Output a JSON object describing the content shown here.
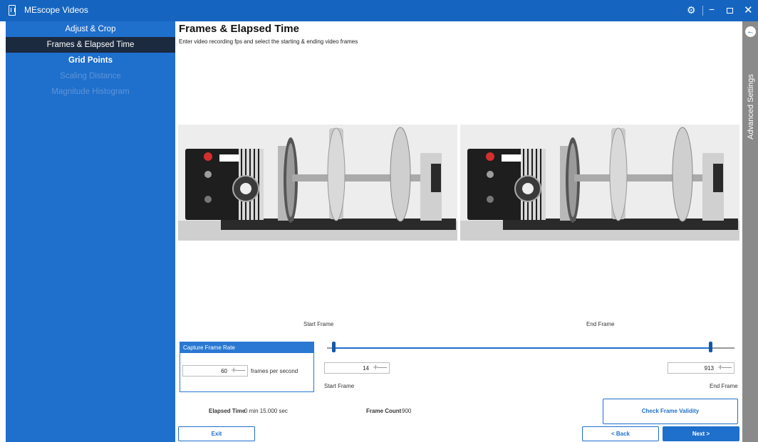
{
  "window": {
    "title": "MEscope Videos"
  },
  "titlebar": {
    "gear_icon": "gear-icon",
    "minimize_glyph": "−",
    "close_glyph": "✕"
  },
  "sidebar": {
    "items": [
      {
        "label": "Adjust & Crop",
        "state": "normal"
      },
      {
        "label": "Frames & Elapsed Time",
        "state": "active"
      },
      {
        "label": "Grid Points",
        "state": "bold"
      },
      {
        "label": "Scaling Distance",
        "state": "disabled"
      },
      {
        "label": "Magnitude Histogram",
        "state": "disabled"
      }
    ]
  },
  "main": {
    "title": "Frames & Elapsed Time",
    "subtitle": "Enter video recording fps and select the starting & ending video frames",
    "start_frame_caption": "Start Frame",
    "end_frame_caption": "End Frame"
  },
  "capture": {
    "header": "Capture Frame Rate",
    "fps_value": "60",
    "units": "frames per second"
  },
  "slider": {
    "start_value": "14",
    "end_value": "913",
    "start_label": "Start Frame",
    "end_label": "End Frame",
    "start_fraction": 0.015,
    "end_fraction": 0.94
  },
  "summary": {
    "elapsed_label": "Elapsed Time",
    "elapsed_value": "0 min 15.000 sec",
    "count_label": "Frame Count",
    "count_value": "900"
  },
  "buttons": {
    "check": "Check Frame Validity",
    "exit": "Exit",
    "back": "< Back",
    "next": "Next >"
  },
  "stepper": {
    "plus": "+",
    "minus": "—"
  },
  "advanced": {
    "label": "Advanced Settings",
    "back_glyph": "←"
  },
  "colors": {
    "titlebar": "#1565c0",
    "sidebar": "#1f6fcc",
    "active_nav": "#1b2a3e",
    "accent": "#1f6fcc",
    "advanced_panel": "#8a8a8a"
  }
}
